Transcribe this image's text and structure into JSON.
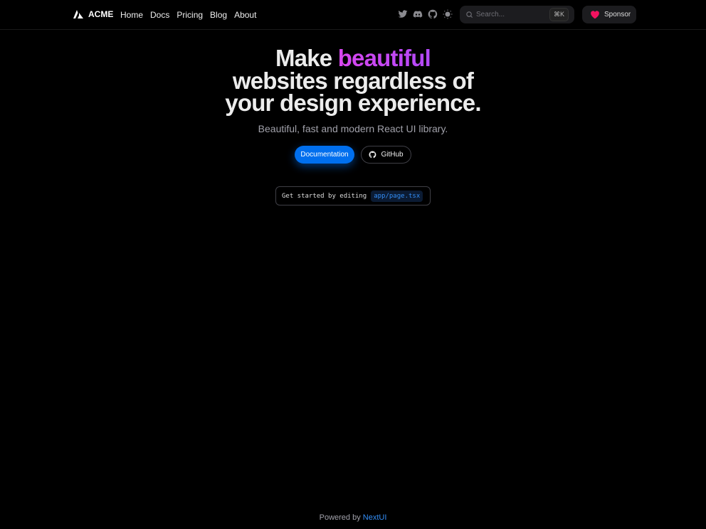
{
  "nav": {
    "brand": "ACME",
    "links": [
      "Home",
      "Docs",
      "Pricing",
      "Blog",
      "About"
    ],
    "search_placeholder": "Search...",
    "search_shortcut": "⌘K",
    "sponsor_label": "Sponsor"
  },
  "hero": {
    "title_pre": "Make ",
    "title_accent": "beautiful",
    "title_line2": "websites regardless of",
    "title_line3": "your design experience.",
    "subtitle": "Beautiful, fast and modern React UI library.",
    "docs_button": "Documentation",
    "github_button": "GitHub",
    "code_prefix": "Get started by editing",
    "code_path": "app/page.tsx"
  },
  "footer": {
    "prefix": "Powered by",
    "link": "NextUI"
  },
  "colors": {
    "accent": "#006fee",
    "gradient": "#d946ef",
    "heart": "#f31260"
  }
}
